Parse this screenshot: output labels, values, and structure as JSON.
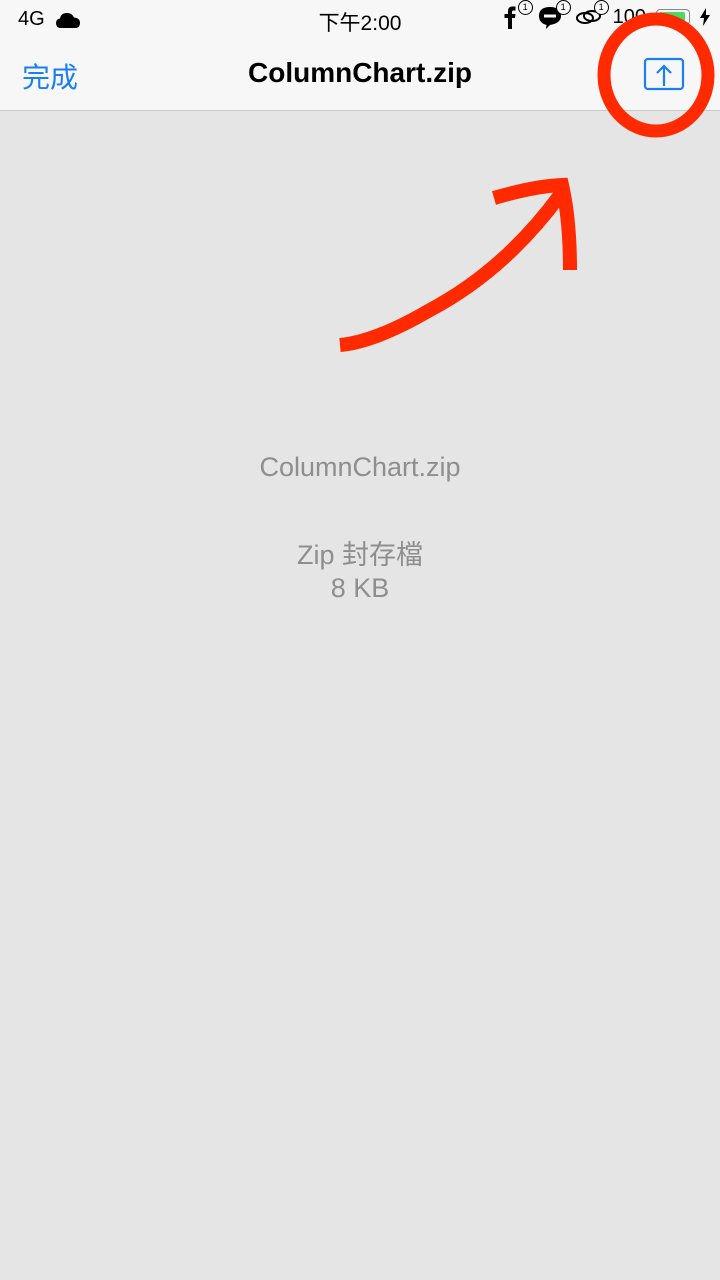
{
  "status_bar": {
    "carrier": "4G",
    "time": "下午2:00",
    "notification_badges": [
      "1",
      "1",
      "1"
    ],
    "battery_text": "100",
    "battery_level": 1.0
  },
  "nav": {
    "done_label": "完成",
    "title": "ColumnChart.zip"
  },
  "file": {
    "name": "ColumnChart.zip",
    "type": "Zip 封存檔",
    "size": "8 KB"
  },
  "colors": {
    "accent": "#1a7ff3",
    "annotation": "#ff2a00",
    "secondary_text": "#8e8e8e",
    "background": "#e5e5e5"
  },
  "icons": [
    "cloud-icon",
    "facebook-icon",
    "line-icon",
    "link-icon",
    "battery-icon",
    "charging-icon",
    "share-icon"
  ]
}
